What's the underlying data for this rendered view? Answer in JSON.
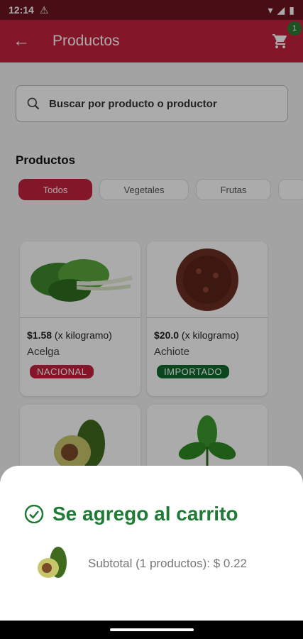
{
  "status_bar": {
    "time": "12:14"
  },
  "app_bar": {
    "title": "Productos",
    "cart_count": "1"
  },
  "search": {
    "placeholder": "Buscar por producto o productor"
  },
  "section": {
    "title": "Productos"
  },
  "filters": [
    {
      "label": "Todos",
      "active": true
    },
    {
      "label": "Vegetales",
      "active": false
    },
    {
      "label": "Frutas",
      "active": false
    }
  ],
  "products": [
    {
      "price": "$1.58",
      "unit": " (x kilogramo)",
      "name": "Acelga",
      "tag": "NACIONAL",
      "tag_color": "#c4213c"
    },
    {
      "price": "$20.0",
      "unit": " (x kilogramo)",
      "name": "Achiote",
      "tag": "IMPORTADO",
      "tag_color": "#0f6b2e"
    }
  ],
  "sheet": {
    "message": "Se agrego al carrito",
    "subtotal": "Subtotal (1 productos): $ 0.22"
  },
  "colors": {
    "primary": "#c4213c",
    "success": "#1f7a35"
  }
}
